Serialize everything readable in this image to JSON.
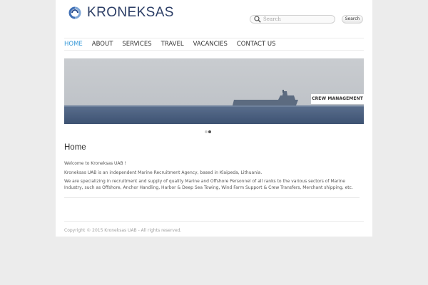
{
  "header": {
    "logo_text": "KRONEKSAS",
    "search_placeholder": "Search",
    "search_button": "Search"
  },
  "nav": {
    "items": [
      {
        "label": "HOME",
        "active": true
      },
      {
        "label": "ABOUT",
        "active": false
      },
      {
        "label": "SERVICES",
        "active": false
      },
      {
        "label": "TRAVEL",
        "active": false
      },
      {
        "label": "VACANCIES",
        "active": false
      },
      {
        "label": "CONTACT US",
        "active": false
      }
    ]
  },
  "slider": {
    "caption": "CREW MANAGEMENT",
    "slide_count": 2,
    "active_slide": 2
  },
  "main": {
    "title": "Home",
    "paragraphs": [
      "Welcome to Kroneksas UAB !",
      "Kroneksas UAB is an independent Marine Recruitment Agency, based in Klaipeda, Lithuania.",
      "We are specializing in recruitment and supply of quality Marine and Offshore Personnel of all ranks to the various sectors of Marine Industry, such as Offshore, Anchor Handling, Harbor & Deep Sea Towing, Wind Farm Support & Crew Transfers, Merchant shipping, etc."
    ]
  },
  "footer": {
    "copyright": "Copyright © 2015 Kroneksas UAB - All rights reserved."
  },
  "colors": {
    "accent": "#3a9bd9",
    "logo": "#2c3e66",
    "page_background": "#ececec"
  }
}
